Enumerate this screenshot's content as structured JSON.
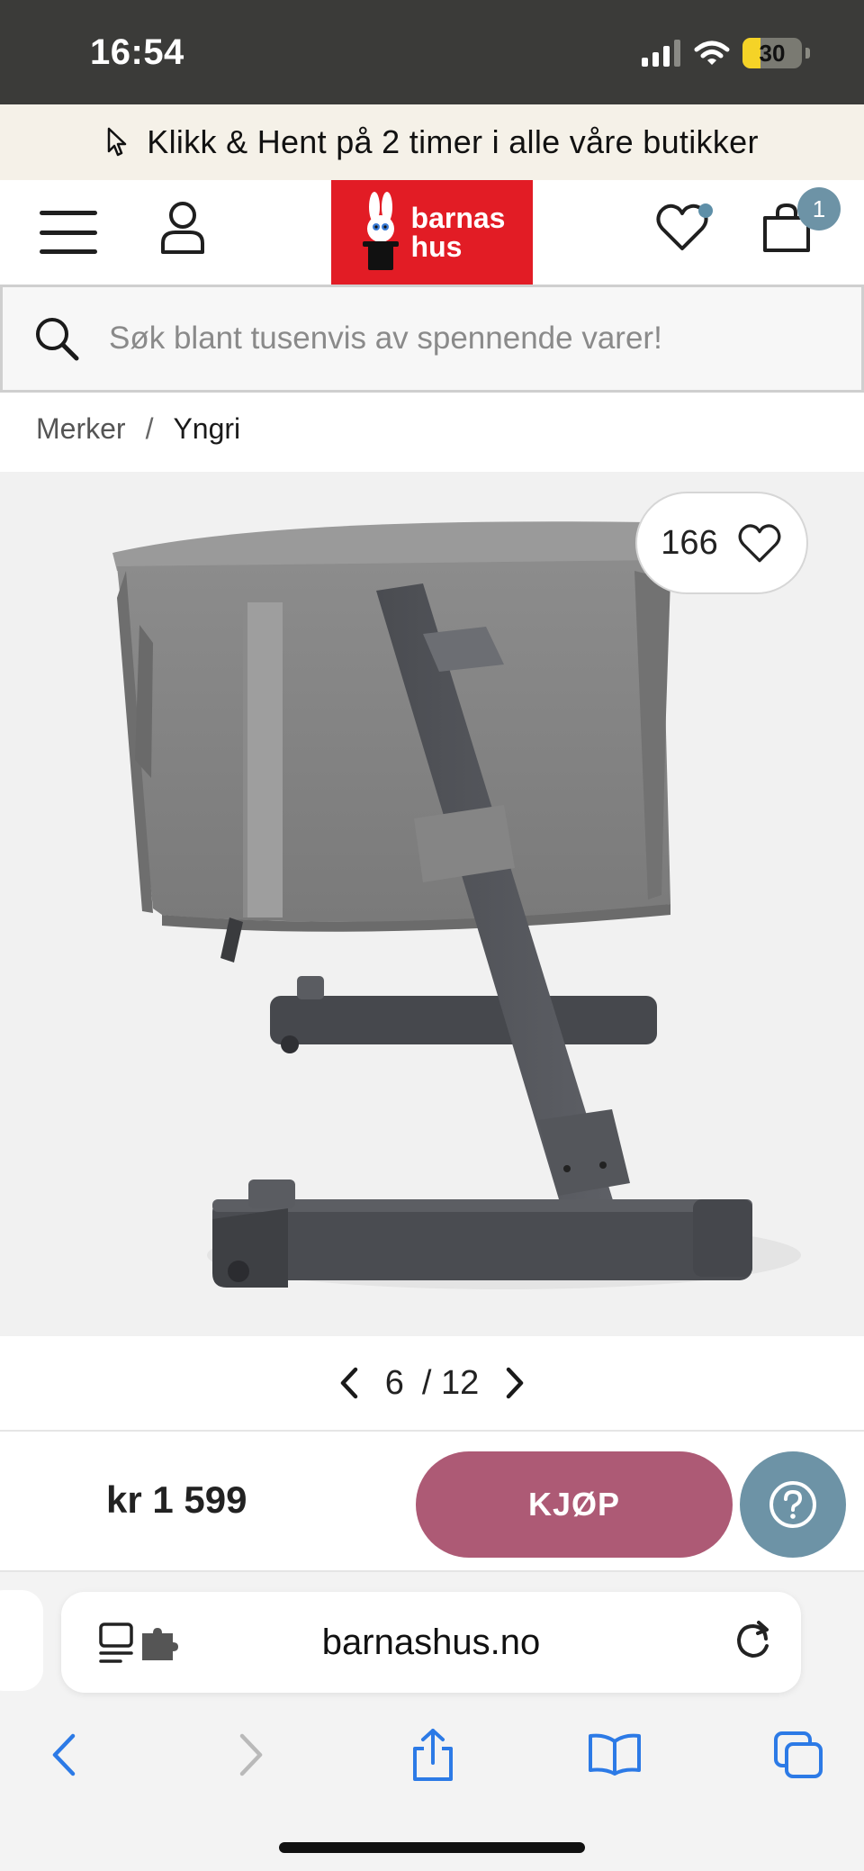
{
  "status_bar": {
    "time": "16:54",
    "battery_level": 30,
    "battery_label": "30"
  },
  "promo": {
    "text": "Klikk & Hent på 2 timer i alle våre butikker"
  },
  "header": {
    "logo_line1": "barnas",
    "logo_line2": "hus",
    "cart_count": "1",
    "colors": {
      "brand_red": "#e21c25",
      "accent_blue": "#6d93a6"
    }
  },
  "search": {
    "placeholder": "Søk blant tusenvis av spennende varer!",
    "value": ""
  },
  "breadcrumb": {
    "items": [
      "Merker",
      "Yngri"
    ],
    "separator": "/"
  },
  "product": {
    "like_count": "166",
    "image_index": "6",
    "image_total": "/ 12",
    "price": "kr 1 599",
    "buy_label": "KJØP",
    "buy_color": "#ad5a75"
  },
  "browser": {
    "url": "barnashus.no"
  }
}
